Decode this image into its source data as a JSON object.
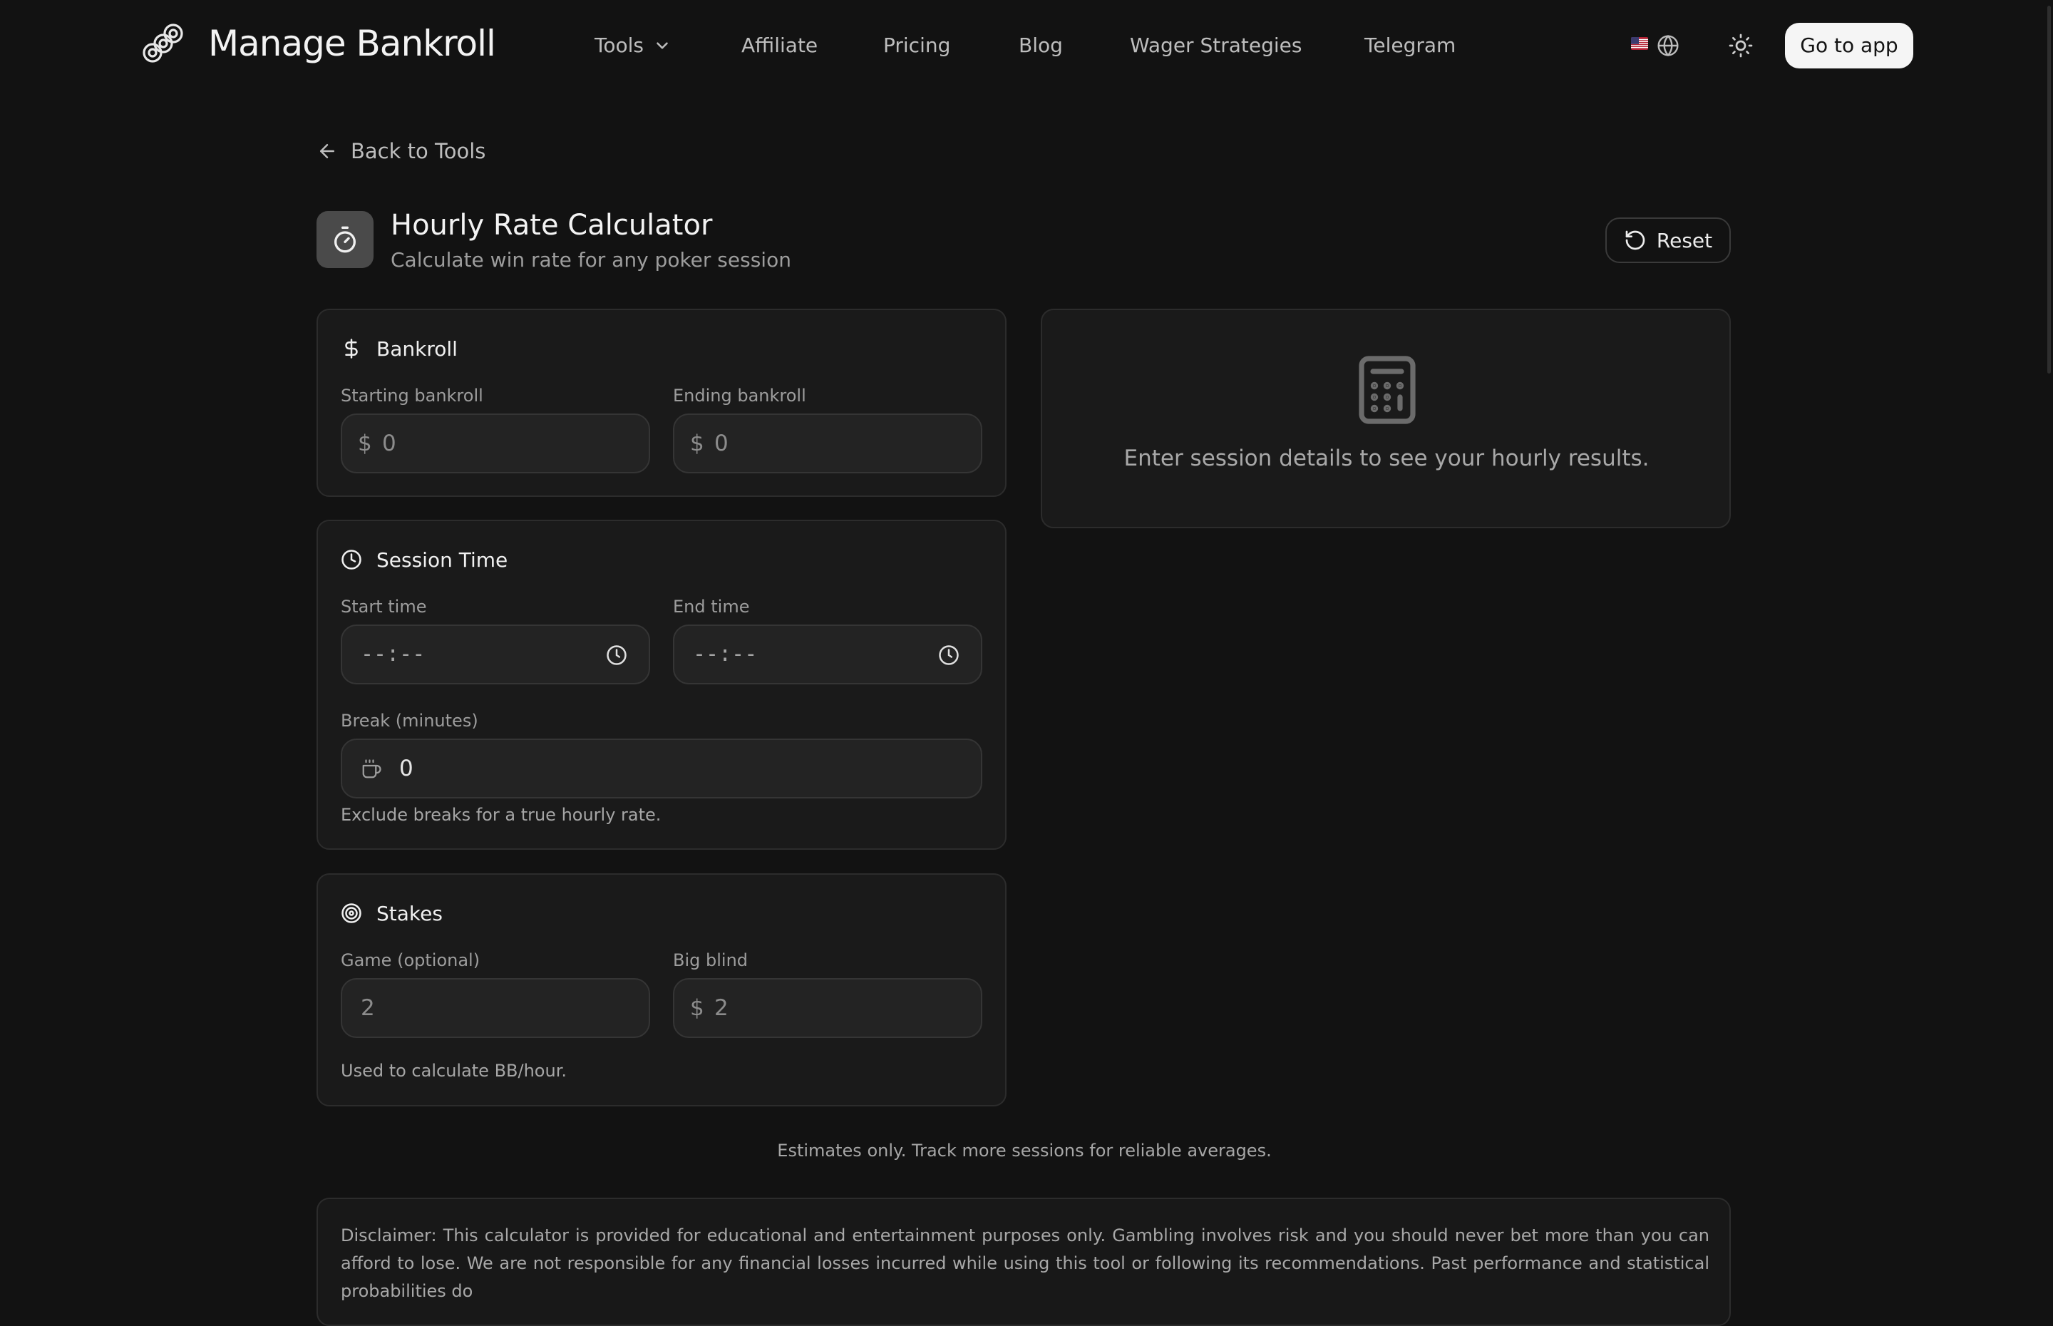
{
  "header": {
    "brand": "Manage Bankroll",
    "nav": {
      "tools": "Tools",
      "affiliate": "Affiliate",
      "pricing": "Pricing",
      "blog": "Blog",
      "wager_strategies": "Wager Strategies",
      "telegram": "Telegram"
    },
    "go_to_app": "Go to app"
  },
  "back_link": "Back to Tools",
  "page": {
    "title": "Hourly Rate Calculator",
    "subtitle": "Calculate win rate for any poker session",
    "reset": "Reset"
  },
  "bankroll": {
    "heading": "Bankroll",
    "starting": {
      "label": "Starting bankroll",
      "prefix": "$",
      "placeholder": "0"
    },
    "ending": {
      "label": "Ending bankroll",
      "prefix": "$",
      "placeholder": "0"
    }
  },
  "session_time": {
    "heading": "Session Time",
    "start": {
      "label": "Start time",
      "placeholder": "--:--"
    },
    "end": {
      "label": "End time",
      "placeholder": "--:--"
    },
    "break": {
      "label": "Break (minutes)",
      "value": "0"
    },
    "help": "Exclude breaks for a true hourly rate."
  },
  "stakes": {
    "heading": "Stakes",
    "game": {
      "label": "Game (optional)",
      "placeholder": "2"
    },
    "big_blind": {
      "label": "Big blind",
      "prefix": "$",
      "placeholder": "2"
    },
    "help": "Used to calculate BB/hour."
  },
  "results": {
    "empty_text": "Enter session details to see your hourly results."
  },
  "estimates_note": "Estimates only. Track more sessions for reliable averages.",
  "disclaimer": "Disclaimer: This calculator is provided for educational and entertainment purposes only. Gambling involves risk and you should never bet more than you can afford to lose. We are not responsible for any financial losses incurred while using this tool or following its recommendations. Past performance and statistical probabilities do",
  "colors": {
    "background": "#121212",
    "card": "#1a1a1a",
    "input": "#232323",
    "border": "#2c2c2c",
    "text": "#ededed",
    "muted": "#9d9d9d",
    "button_bg": "#f5f5f5"
  },
  "icons": {
    "logo": "chips-logo-icon",
    "tools_menu": "chevron-down-icon",
    "flag": "us-flag-icon",
    "language": "globe-icon",
    "theme": "sun-icon",
    "back": "arrow-left-icon",
    "title": "stopwatch-icon",
    "reset": "rotate-ccw-icon",
    "bankroll": "dollar-icon",
    "session_time": "clock-icon",
    "break": "coffee-icon",
    "stakes": "target-icon",
    "results": "calculator-icon"
  }
}
